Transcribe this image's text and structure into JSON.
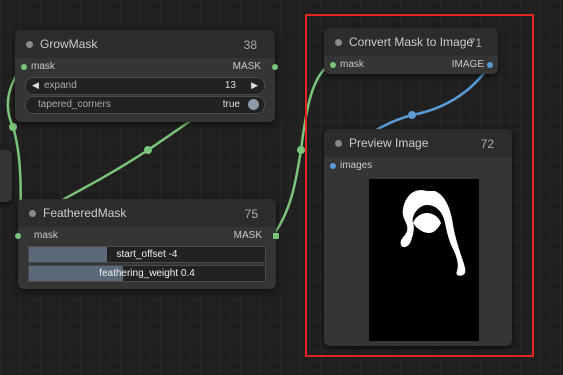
{
  "nodes": {
    "grow_mask": {
      "title": "GrowMask",
      "id": "38",
      "input_label": "mask",
      "output_label": "MASK",
      "widgets": {
        "expand": {
          "name": "expand",
          "value": "13"
        },
        "tapered_corners": {
          "name": "tapered_corners",
          "value": "true"
        }
      }
    },
    "feathered_mask": {
      "title": "FeatheredMask",
      "id": "75",
      "input_label": "mask",
      "output_label": "MASK",
      "widgets": {
        "start_offset": {
          "name": "start_offset",
          "value": "-4",
          "level": 0.33
        },
        "feathering_weight": {
          "name": "feathering_weight",
          "value": "0.4",
          "level": 0.4
        }
      }
    },
    "convert_mask": {
      "title": "Convert Mask to Image",
      "id": "71",
      "input_label": "mask",
      "output_label": "IMAGE"
    },
    "preview_image": {
      "title": "Preview Image",
      "id": "72",
      "input_label": "images"
    }
  },
  "colors": {
    "mask_wire": "#7bc47b",
    "image_wire": "#5b9bd5",
    "highlight": "#e0261e",
    "node_body": "#353535",
    "canvas": "#1f1f1f"
  },
  "icons": {
    "decrement": "triangle-left",
    "increment": "triangle-right",
    "preview_content": "white-silhouette-on-black"
  }
}
